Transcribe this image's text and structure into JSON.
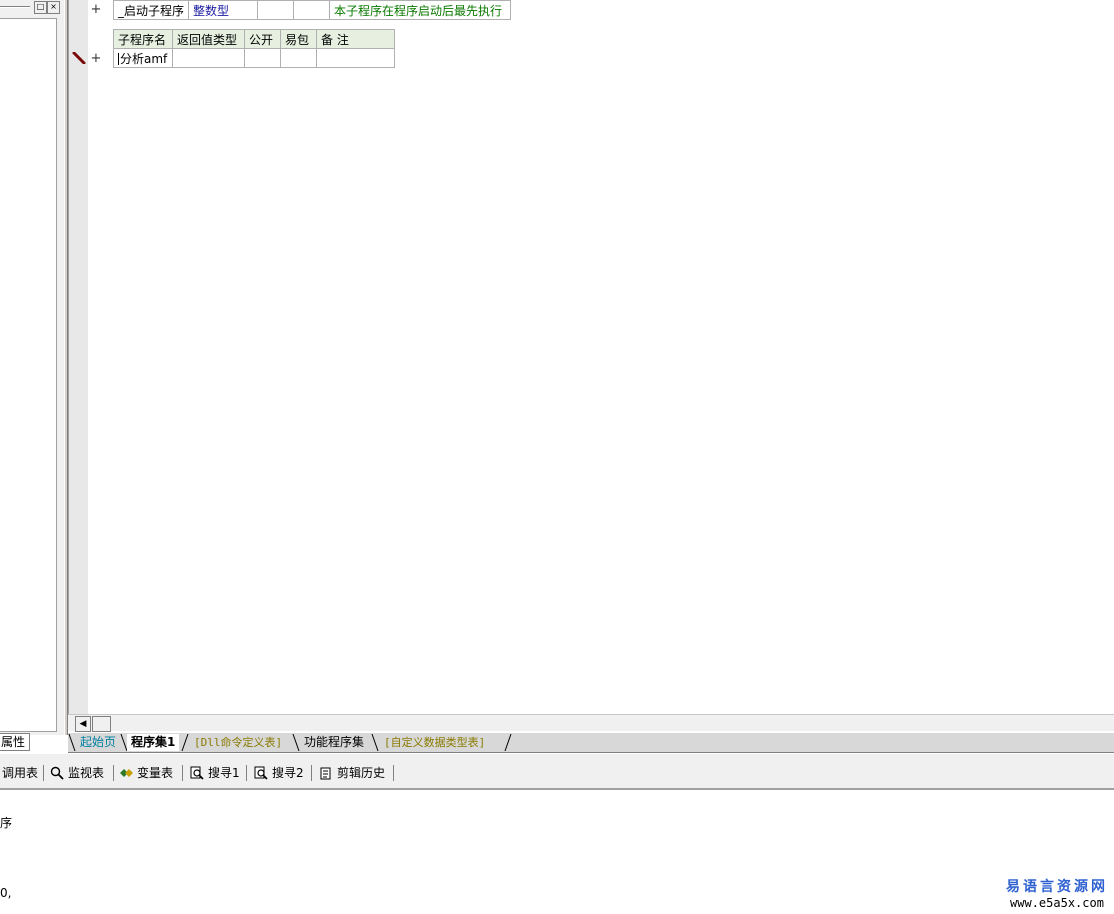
{
  "left_panel": {
    "properties_tab": "属性"
  },
  "startup_row": {
    "name": "_启动子程序",
    "return_type": "整数型",
    "public": "",
    "easy_pack": "",
    "remark": "本子程序在程序启动后最先执行"
  },
  "subroutine_table": {
    "headers": [
      "子程序名",
      "返回值类型",
      "公开",
      "易包",
      "备 注"
    ],
    "row": {
      "name": "分析amf",
      "return_type": "",
      "public": "",
      "easy_pack": "",
      "remark": ""
    }
  },
  "gutter": {
    "plus_symbol": "+"
  },
  "tabs": [
    {
      "label": "起始页"
    },
    {
      "label": "程序集1"
    },
    {
      "label": "[Dll命令定义表]"
    },
    {
      "label": "功能程序集"
    },
    {
      "label": "[自定义数据类型表]"
    }
  ],
  "toolbar": {
    "call_table": "调用表",
    "watch_table": "监视表",
    "var_table": "变量表",
    "search1": "搜寻1",
    "search2": "搜寻2",
    "clip_history": "剪辑历史"
  },
  "output": {
    "line1": "序",
    "line2": "0,"
  },
  "watermark": {
    "name": "易语言资源网",
    "url": "www.e5a5x.com"
  },
  "colors": {
    "remark_green": "#0a7a00",
    "type_navy": "#1a1aa0",
    "tab_teal": "#0080a0",
    "tab_olive": "#8a7a00",
    "watermark_blue": "#2f62d0"
  }
}
